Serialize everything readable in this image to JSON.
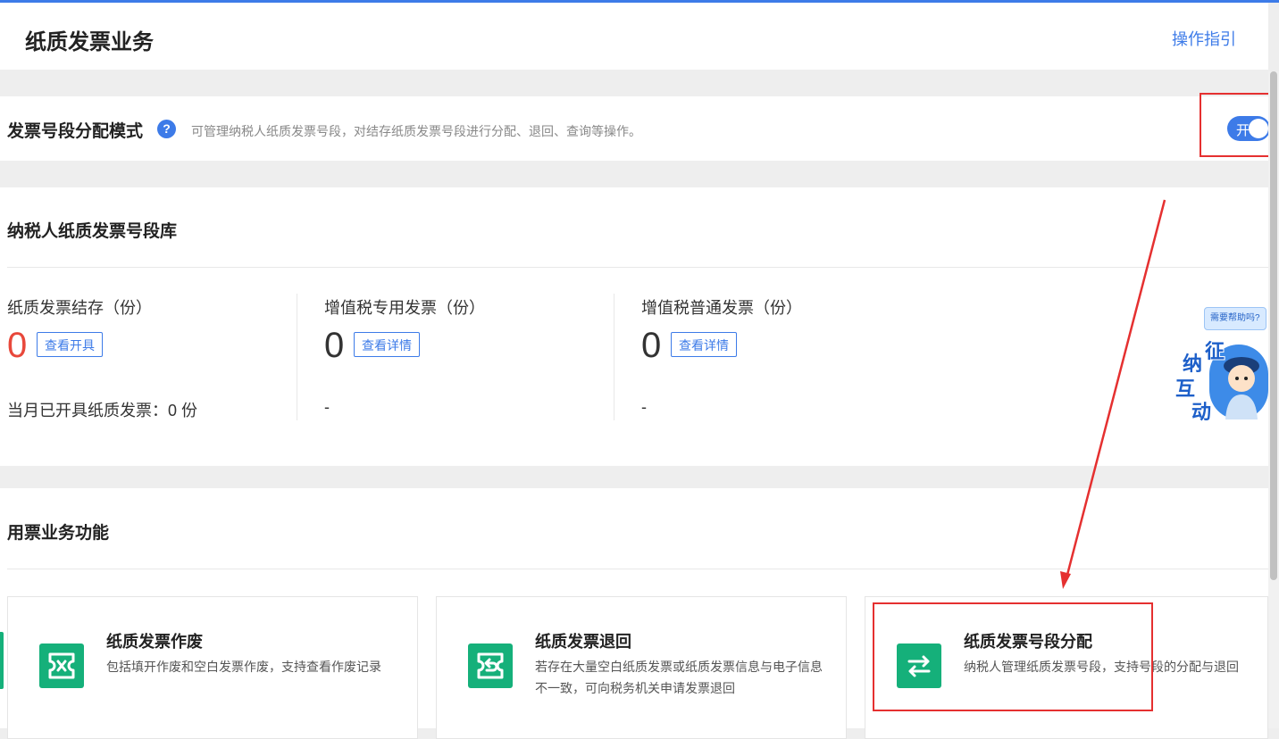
{
  "header": {
    "title": "纸质发票业务",
    "guide_link": "操作指引"
  },
  "mode": {
    "title": "发票号段分配模式",
    "help_glyph": "?",
    "description": "可管理纳税人纸质发票号段，对结存纸质发票号段进行分配、退回、查询等操作。",
    "toggle_label": "开",
    "toggle_on": true
  },
  "library": {
    "title": "纳税人纸质发票号段库",
    "stats": [
      {
        "label": "纸质发票结存（份）",
        "value": "0",
        "button": "查看开具",
        "footer": "当月已开具纸质发票：0 份",
        "value_color": "#e8483b"
      },
      {
        "label": "增值税专用发票（份）",
        "value": "0",
        "button": "查看详情",
        "footer": "-",
        "value_color": "#333333"
      },
      {
        "label": "增值税普通发票（份）",
        "value": "0",
        "button": "查看详情",
        "footer": "-",
        "value_color": "#333333"
      }
    ]
  },
  "functions": {
    "title": "用票业务功能",
    "cards": [
      {
        "title": "纸质发票作废",
        "desc": "包括填开作废和空白发票作废，支持查看作废记录",
        "icon": "void-invoice-icon"
      },
      {
        "title": "纸质发票退回",
        "desc": "若存在大量空白纸质发票或纸质发票信息与电子信息不一致，可向税务机关申请发票退回",
        "icon": "return-invoice-icon"
      },
      {
        "title": "纸质发票号段分配",
        "desc": "纳税人管理纸质发票号段，支持号段的分配与退回",
        "icon": "exchange-arrows-icon"
      }
    ]
  },
  "assistant": {
    "bubble": "需要帮助吗?",
    "chars": [
      "征",
      "纳",
      "互",
      "动"
    ]
  },
  "colors": {
    "accent": "#3d7be8",
    "green": "#15b07a",
    "highlight": "#e53030",
    "zero_red": "#e8483b"
  }
}
